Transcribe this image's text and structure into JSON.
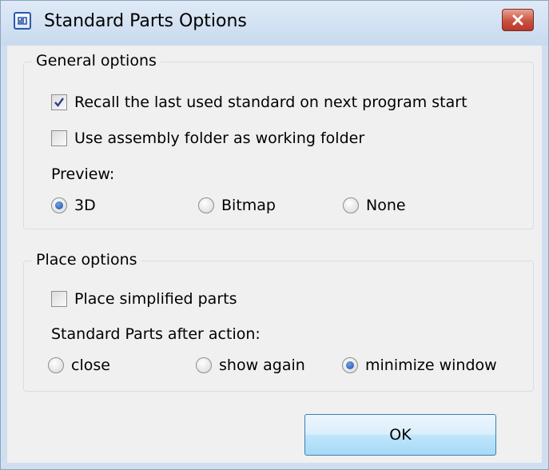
{
  "window": {
    "title": "Standard Parts Options",
    "icon": "app-icon",
    "close_icon": "close-icon"
  },
  "general": {
    "legend": "General options",
    "recall_label": "Recall the last used standard on next program start",
    "recall_checked": true,
    "assembly_label": "Use assembly folder as working folder",
    "assembly_checked": false,
    "preview_label": "Preview:",
    "preview_options": [
      "3D",
      "Bitmap",
      "None"
    ],
    "preview_selected": "3D"
  },
  "place": {
    "legend": "Place options",
    "simplified_label": "Place simplified parts",
    "simplified_checked": false,
    "after_action_label": "Standard Parts after action:",
    "after_action_options": [
      "close",
      "show again",
      "minimize window"
    ],
    "after_action_selected": "minimize window"
  },
  "buttons": {
    "ok_label": "OK"
  },
  "colors": {
    "title_bar": "#cfdff0",
    "client_bg": "#f0f0f0",
    "close_button": "#c9523f",
    "ok_button": "#bee6fd",
    "radio_dot": "#1f4f9c"
  }
}
